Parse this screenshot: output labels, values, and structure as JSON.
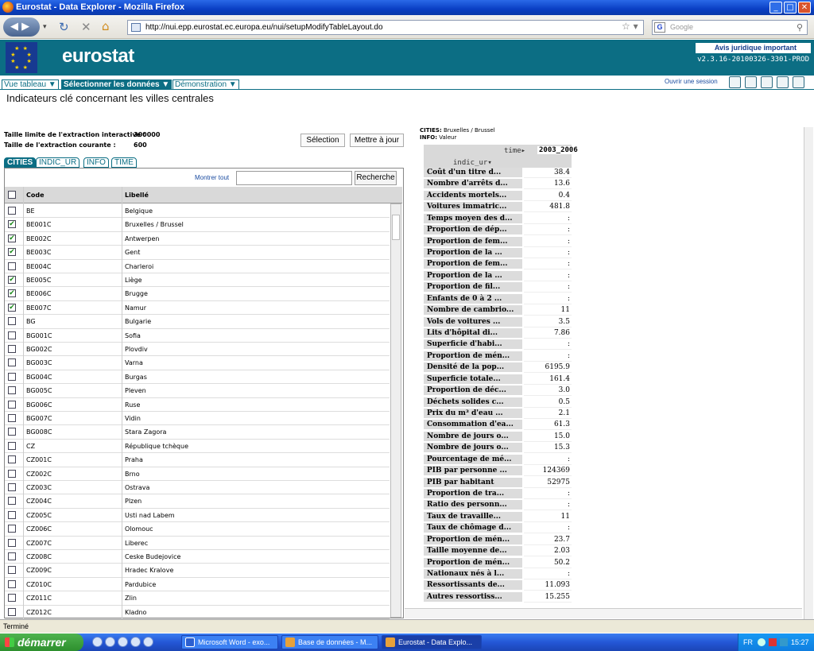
{
  "window": {
    "title": "Eurostat - Data Explorer - Mozilla Firefox"
  },
  "browser": {
    "url": "http://nui.epp.eurostat.ec.europa.eu/nui/setupModifyTableLayout.do",
    "search_placeholder": "Google",
    "status": "Terminé"
  },
  "header": {
    "logo": "eurostat",
    "legal": "Avis juridique important",
    "version": "v2.3.16-20100326-3301-PROD"
  },
  "menu": {
    "tabs": [
      "Vue tableau ▼",
      "Sélectionner les données ▼",
      "Démonstration ▼"
    ],
    "session": "Ouvrir une session"
  },
  "page": {
    "title": "Indicateurs clé concernant les villes centrales",
    "limit_label": "Taille limite de l'extraction interactive :",
    "limit_value": "300000",
    "current_label": "Taille de l'extraction courante :",
    "current_value": "600",
    "selection_btn": "Sélection",
    "update_btn": "Mettre à jour"
  },
  "dim_tabs": [
    "CITIES",
    "INDIC_UR",
    "INFO",
    "TIME"
  ],
  "list": {
    "show_all": "Montrer tout",
    "search_btn": "Recherche",
    "col_code": "Code",
    "col_label": "Libellé",
    "rows": [
      {
        "code": "BE",
        "label": "Belgique",
        "checked": false
      },
      {
        "code": "BE001C",
        "label": "Bruxelles / Brussel",
        "checked": true
      },
      {
        "code": "BE002C",
        "label": "Antwerpen",
        "checked": true
      },
      {
        "code": "BE003C",
        "label": "Gent",
        "checked": true
      },
      {
        "code": "BE004C",
        "label": "Charleroi",
        "checked": false
      },
      {
        "code": "BE005C",
        "label": "Liège",
        "checked": true
      },
      {
        "code": "BE006C",
        "label": "Brugge",
        "checked": true
      },
      {
        "code": "BE007C",
        "label": "Namur",
        "checked": true
      },
      {
        "code": "BG",
        "label": "Bulgarie",
        "checked": false
      },
      {
        "code": "BG001C",
        "label": "Sofia",
        "checked": false
      },
      {
        "code": "BG002C",
        "label": "Plovdiv",
        "checked": false
      },
      {
        "code": "BG003C",
        "label": "Varna",
        "checked": false
      },
      {
        "code": "BG004C",
        "label": "Burgas",
        "checked": false
      },
      {
        "code": "BG005C",
        "label": "Pleven",
        "checked": false
      },
      {
        "code": "BG006C",
        "label": "Ruse",
        "checked": false
      },
      {
        "code": "BG007C",
        "label": "Vidin",
        "checked": false
      },
      {
        "code": "BG008C",
        "label": "Stara Zagora",
        "checked": false
      },
      {
        "code": "CZ",
        "label": "République tchèque",
        "checked": false
      },
      {
        "code": "CZ001C",
        "label": "Praha",
        "checked": false
      },
      {
        "code": "CZ002C",
        "label": "Brno",
        "checked": false
      },
      {
        "code": "CZ003C",
        "label": "Ostrava",
        "checked": false
      },
      {
        "code": "CZ004C",
        "label": "Plzen",
        "checked": false
      },
      {
        "code": "CZ005C",
        "label": "Usti nad Labem",
        "checked": false
      },
      {
        "code": "CZ006C",
        "label": "Olomouc",
        "checked": false
      },
      {
        "code": "CZ007C",
        "label": "Liberec",
        "checked": false
      },
      {
        "code": "CZ008C",
        "label": "Ceske Budejovice",
        "checked": false
      },
      {
        "code": "CZ009C",
        "label": "Hradec Kralove",
        "checked": false
      },
      {
        "code": "CZ010C",
        "label": "Pardubice",
        "checked": false
      },
      {
        "code": "CZ011C",
        "label": "Zlin",
        "checked": false
      },
      {
        "code": "CZ012C",
        "label": "Kladno",
        "checked": false
      }
    ]
  },
  "result": {
    "cities_label": "CITIES:",
    "cities_value": "Bruxelles / Brussel",
    "info_label": "INFO:",
    "info_value": "Valeur",
    "time_label": "time▸",
    "time_value": "2003_2006",
    "indic_label": "indic_ur▾",
    "rows": [
      {
        "label": "Coût d'un titre d...",
        "value": "38.4"
      },
      {
        "label": "Nombre d'arrêts d...",
        "value": "13.6"
      },
      {
        "label": "Accidents mortels...",
        "value": "0.4"
      },
      {
        "label": "Voitures immatric...",
        "value": "481.8"
      },
      {
        "label": "Temps moyen des d...",
        "value": ":"
      },
      {
        "label": "Proportion de dép...",
        "value": ":"
      },
      {
        "label": "Proportion de fem...",
        "value": ":"
      },
      {
        "label": "Proportion de la ...",
        "value": ":"
      },
      {
        "label": "Proportion de fem...",
        "value": ":"
      },
      {
        "label": "Proportion de la ...",
        "value": ":"
      },
      {
        "label": "Proportion de fil...",
        "value": ":"
      },
      {
        "label": "Enfants de 0 à 2 ...",
        "value": ":"
      },
      {
        "label": "Nombre de cambrio...",
        "value": "11"
      },
      {
        "label": "Vols de voitures ...",
        "value": "3.5"
      },
      {
        "label": "Lits d'hôpital di...",
        "value": "7.86"
      },
      {
        "label": "Superficie d'habi...",
        "value": ":"
      },
      {
        "label": "Proportion de mén...",
        "value": ":"
      },
      {
        "label": "Densité de la pop...",
        "value": "6195.9"
      },
      {
        "label": "Superficie totale...",
        "value": "161.4"
      },
      {
        "label": "Proportion de déc...",
        "value": "3.0"
      },
      {
        "label": "Déchets solides c...",
        "value": "0.5"
      },
      {
        "label": "Prix du m³ d'eau ...",
        "value": "2.1"
      },
      {
        "label": "Consommation d'ea...",
        "value": "61.3"
      },
      {
        "label": "Nombre de jours o...",
        "value": "15.0"
      },
      {
        "label": "Nombre de jours o...",
        "value": "15.3"
      },
      {
        "label": "Pourcentage de mé...",
        "value": ":"
      },
      {
        "label": "PIB par personne ...",
        "value": "124369"
      },
      {
        "label": "PIB par habitant",
        "value": "52975"
      },
      {
        "label": "Proportion de tra...",
        "value": ":"
      },
      {
        "label": "Ratio des personn...",
        "value": ":"
      },
      {
        "label": "Taux de travaille...",
        "value": "11"
      },
      {
        "label": "Taux de chômage d...",
        "value": ":"
      },
      {
        "label": "Proportion de mén...",
        "value": "23.7"
      },
      {
        "label": "Taille moyenne de...",
        "value": "2.03"
      },
      {
        "label": "Proportion de mén...",
        "value": "50.2"
      },
      {
        "label": "Nationaux nés à l...",
        "value": ":"
      },
      {
        "label": "Ressortissants de...",
        "value": "11.093"
      },
      {
        "label": "Autres ressortiss...",
        "value": "15.255"
      }
    ]
  },
  "taskbar": {
    "start": "démarrer",
    "tasks": [
      "Microsoft Word - exo...",
      "Base de données - M...",
      "Eurostat - Data Explo..."
    ],
    "lang": "FR",
    "clock": "15:27"
  }
}
